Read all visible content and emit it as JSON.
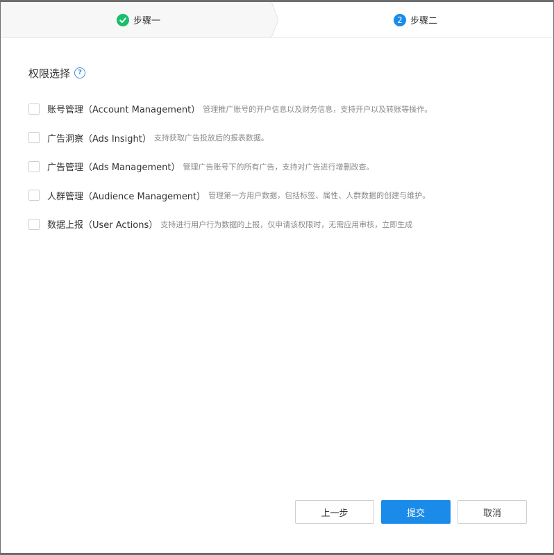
{
  "steps": [
    {
      "label": "步骤一",
      "status": "done"
    },
    {
      "number": "2",
      "label": "步骤二",
      "status": "active"
    }
  ],
  "section": {
    "title": "权限选择",
    "help_icon": "?"
  },
  "permissions": [
    {
      "name": "账号管理（Account Management）",
      "desc": "管理推广账号的开户信息以及财务信息，支持开户以及转账等操作。",
      "checked": false
    },
    {
      "name": "广告洞察（Ads Insight）",
      "desc": "支持获取广告投放后的报表数据。",
      "checked": false
    },
    {
      "name": "广告管理（Ads Management）",
      "desc": "管理广告账号下的所有广告，支持对广告进行增删改查。",
      "checked": false
    },
    {
      "name": "人群管理（Audience Management）",
      "desc": "管理第一方用户数据，包括标签、属性、人群数据的创建与维护。",
      "checked": false
    },
    {
      "name": "数据上报（User Actions）",
      "desc": "支持进行用户行为数据的上报，仅申请该权限时，无需应用审核，立即生成",
      "checked": false
    }
  ],
  "buttons": {
    "prev": "上一步",
    "submit": "提交",
    "cancel": "取消"
  },
  "colors": {
    "primary": "#1a8be8",
    "success": "#19be6b",
    "text": "#333333",
    "muted": "#8a8a8a"
  }
}
